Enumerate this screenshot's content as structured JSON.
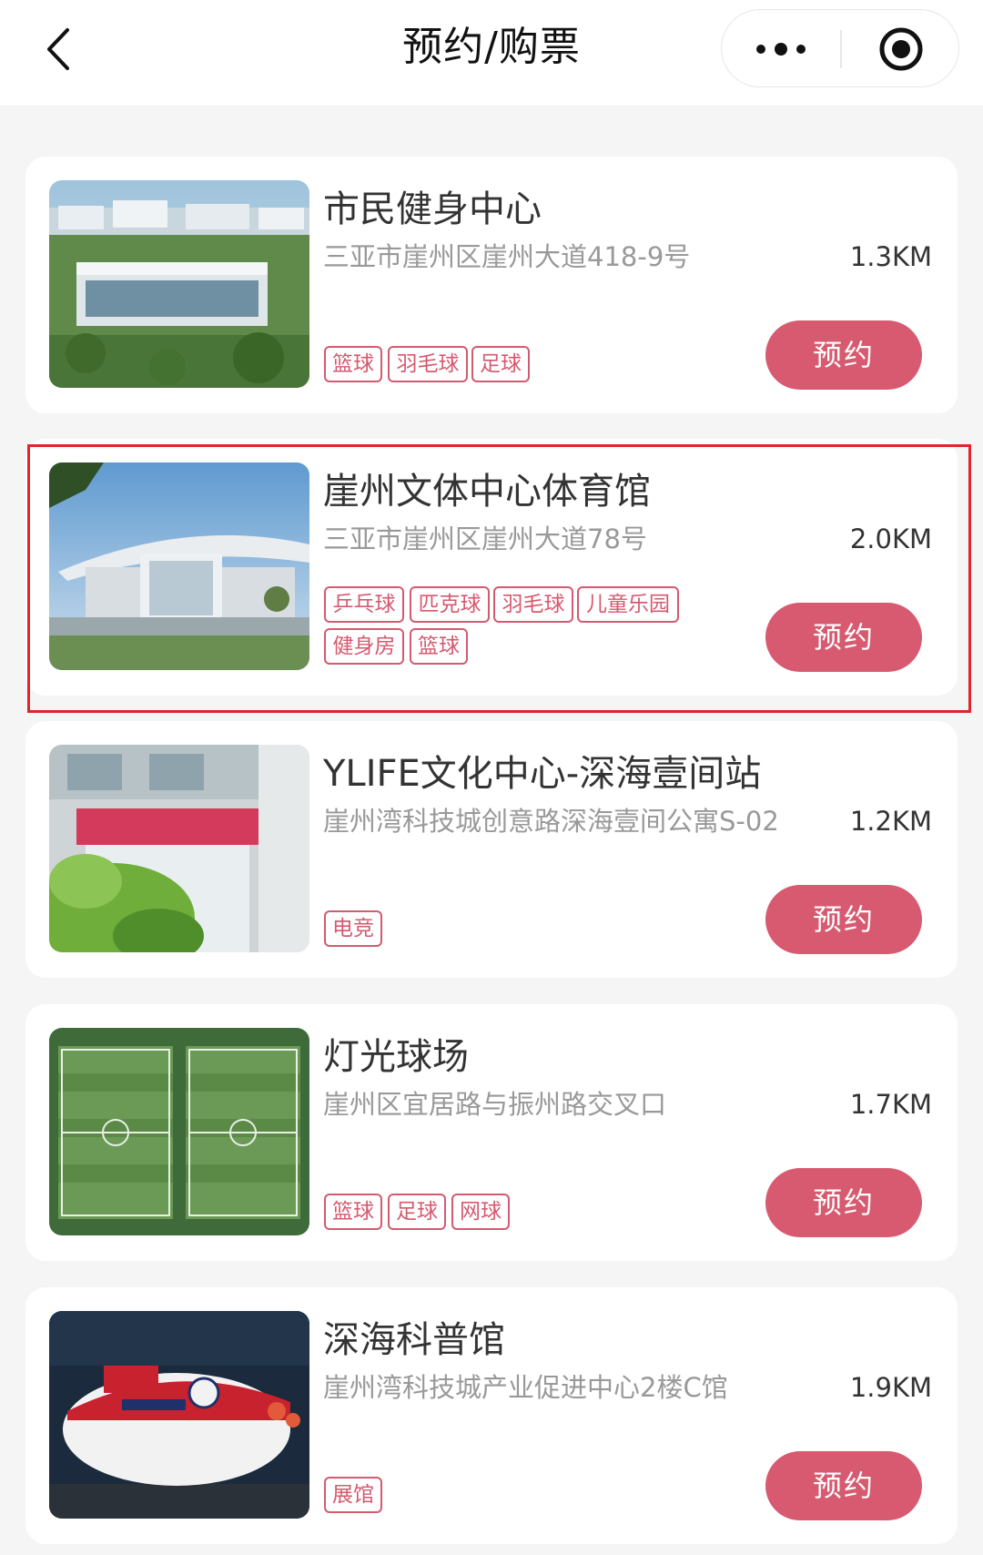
{
  "header": {
    "title": "预约/购票",
    "back_icon": "chevron-left-icon",
    "more_icon": "more-dots-icon",
    "close_icon": "target-circle-icon"
  },
  "accent_color": "#d75a70",
  "highlight_color": "#e0262c",
  "venues": [
    {
      "name": "市民健身中心",
      "address": "三亚市崖州区崖州大道418-9号",
      "distance": "1.3KM",
      "tags": [
        "篮球",
        "羽毛球",
        "足球"
      ],
      "button": "预约"
    },
    {
      "name": "崖州文体中心体育馆",
      "address": "三亚市崖州区崖州大道78号",
      "distance": "2.0KM",
      "tags": [
        "乒乓球",
        "匹克球",
        "羽毛球",
        "儿童乐园",
        "健身房",
        "篮球"
      ],
      "button": "预约"
    },
    {
      "name": "YLIFE文化中心-深海壹间站",
      "address": "崖州湾科技城创意路深海壹间公寓S-02",
      "distance": "1.2KM",
      "tags": [
        "电竞"
      ],
      "button": "预约"
    },
    {
      "name": "灯光球场",
      "address": "崖州区宜居路与振州路交叉口",
      "distance": "1.7KM",
      "tags": [
        "篮球",
        "足球",
        "网球"
      ],
      "button": "预约"
    },
    {
      "name": "深海科普馆",
      "address": "崖州湾科技城产业促进中心2楼C馆",
      "distance": "1.9KM",
      "tags": [
        "展馆"
      ],
      "button": "预约"
    }
  ]
}
